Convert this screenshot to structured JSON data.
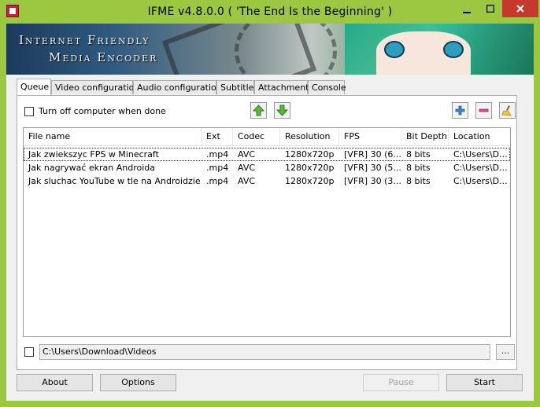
{
  "window": {
    "title": "IFME v4.8.0.0 ( 'The End Is the Beginning' )",
    "close_icon": "close-icon",
    "colors": {
      "frame": "#9bc741",
      "close": "#c7382c"
    }
  },
  "banner": {
    "line1": "Internet Friendly",
    "line2": "Media Encoder"
  },
  "tabs": [
    {
      "label": "Queue"
    },
    {
      "label": "Video configuration"
    },
    {
      "label": "Audio configuration"
    },
    {
      "label": "Subtitle"
    },
    {
      "label": "Attachment"
    },
    {
      "label": "Console"
    }
  ],
  "queue": {
    "shutdown_label": "Turn off computer when done",
    "columns": [
      "File name",
      "Ext",
      "Codec",
      "Resolution",
      "FPS",
      "Bit Depth",
      "Location"
    ],
    "rows": [
      [
        "Jak zwiekszyc FPS w Minecraft",
        ".mp4",
        "AVC",
        "1280x720p",
        "[VFR] 30 (6...",
        "8 bits",
        "C:\\Users\\D..."
      ],
      [
        "Jak nagrywać ekran Androida",
        ".mp4",
        "AVC",
        "1280x720p",
        "[VFR] 30 (5...",
        "8 bits",
        "C:\\Users\\D..."
      ],
      [
        "Jak sluchac YouTube w tle na Androidzie",
        ".mp4",
        "AVC",
        "1280x720p",
        "[VFR] 30 (3...",
        "8 bits",
        "C:\\Users\\D..."
      ]
    ],
    "output_path": "C:\\Users\\Download\\Videos",
    "browse_label": "..."
  },
  "buttons": {
    "about": "About",
    "options": "Options",
    "pause": "Pause",
    "start": "Start"
  }
}
